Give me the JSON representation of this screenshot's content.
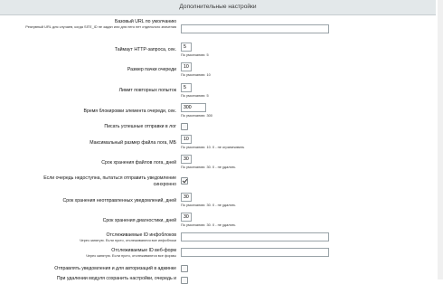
{
  "section_title": "Дополнительные настройки",
  "rows": [
    {
      "label": "Базовый URL по умолчанию",
      "sublabel": "Резервный URL для случаев, когда SITE_ID не задан или для него нет отдельного значения",
      "value": "",
      "hint": ""
    },
    {
      "label": "Таймаут HTTP-запроса, сек.",
      "value": "5",
      "hint": "По умолчанию: 5"
    },
    {
      "label": "Размер пачки очереди",
      "value": "10",
      "hint": "По умолчанию: 10"
    },
    {
      "label": "Лимит повторных попыток",
      "value": "5",
      "hint": "По умолчанию: 5"
    },
    {
      "label": "Время блокировки элемента очереди, сек.",
      "value": "300",
      "hint": "По умолчанию: 300"
    },
    {
      "label": "Писать успешные отправки в лог",
      "checked": false
    },
    {
      "label": "Максимальный размер файла лога, МБ",
      "value": "10",
      "hint": "По умолчанию: 10. 0 - не ограничивать"
    },
    {
      "label": "Срок хранения файлов лога, дней",
      "value": "30",
      "hint": "По умолчанию: 30. 0 - не удалять"
    },
    {
      "label": "Если очередь недоступна, пытаться отправить уведомление синхронно",
      "checked": true
    },
    {
      "label": "Срок хранения неотправленных уведомлений, дней",
      "value": "30",
      "hint": "По умолчанию: 30. 0 - не удалять"
    },
    {
      "label": "Срок хранения диагностики, дней",
      "value": "30",
      "hint": "По умолчанию: 30. 0 - не удалять"
    },
    {
      "label": "Отслеживаемые ID инфоблоков",
      "sublabel": "Через запятую. Если пусто, отслеживаются все инфоблоки",
      "value": "",
      "hint": ""
    },
    {
      "label": "Отслеживаемые ID веб-форм",
      "sublabel": "Через запятую. Если пусто, отслеживаются все формы",
      "value": "",
      "hint": ""
    },
    {
      "label": "Отправлять уведомления и для авторизаций в админке",
      "checked": false
    },
    {
      "label": "При удалении модуля сохранить настройки, очередь и",
      "checked": false
    }
  ]
}
